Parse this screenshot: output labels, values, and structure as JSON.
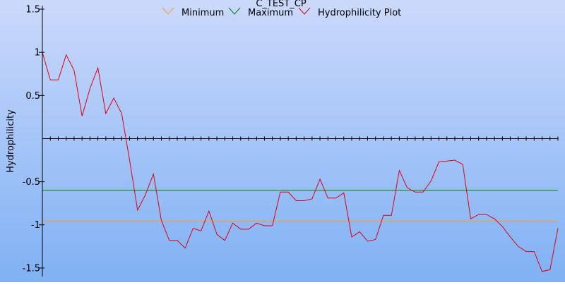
{
  "chart_data": {
    "type": "line",
    "title": "C_TEST_CP",
    "xlabel": "",
    "ylabel": "Hydrophilicity",
    "ylim": [
      -1.55,
      1.5
    ],
    "yticks": [
      1.5,
      1,
      0.5,
      -0.5,
      -1,
      -1.5
    ],
    "ytick_labels": [
      "1.5",
      "1",
      "0.5",
      "-0.5",
      "-1",
      "-1.5"
    ],
    "legend_position": "top-center",
    "series": [
      {
        "name": "Minimum",
        "color": "#f0a030",
        "x": [
          0,
          65
        ],
        "values": [
          -0.96,
          -0.96
        ]
      },
      {
        "name": "Maximum",
        "color": "#008000",
        "x": [
          0,
          65
        ],
        "values": [
          -0.6,
          -0.6
        ]
      },
      {
        "name": "Hydrophilicity Plot",
        "color": "#e00010",
        "x": [
          0,
          1,
          2,
          3,
          4,
          5,
          6,
          7,
          8,
          9,
          10,
          11,
          12,
          13,
          14,
          15,
          16,
          17,
          18,
          19,
          20,
          21,
          22,
          23,
          24,
          25,
          26,
          27,
          28,
          29,
          30,
          31,
          32,
          33,
          34,
          35,
          36,
          37,
          38,
          39,
          40,
          41,
          42,
          43,
          44,
          45,
          46,
          47,
          48,
          49,
          50,
          51,
          52,
          53,
          54,
          55,
          56,
          57,
          58,
          59,
          60,
          61,
          62,
          63,
          64,
          65
        ],
        "values": [
          1.0,
          0.68,
          0.68,
          0.97,
          0.79,
          0.26,
          0.58,
          0.82,
          0.29,
          0.47,
          0.29,
          -0.25,
          -0.83,
          -0.65,
          -0.41,
          -0.95,
          -1.18,
          -1.18,
          -1.27,
          -1.04,
          -1.07,
          -0.84,
          -1.11,
          -1.18,
          -0.98,
          -1.05,
          -1.05,
          -0.98,
          -1.01,
          -1.01,
          -0.62,
          -0.62,
          -0.72,
          -0.72,
          -0.7,
          -0.47,
          -0.69,
          -0.69,
          -0.63,
          -1.14,
          -1.08,
          -1.19,
          -1.17,
          -0.89,
          -0.89,
          -0.37,
          -0.57,
          -0.62,
          -0.62,
          -0.49,
          -0.27,
          -0.26,
          -0.25,
          -0.3,
          -0.93,
          -0.88,
          -0.88,
          -0.93,
          -1.02,
          -1.14,
          -1.25,
          -1.31,
          -1.31,
          -1.54,
          -1.52,
          -1.04
        ]
      }
    ]
  }
}
